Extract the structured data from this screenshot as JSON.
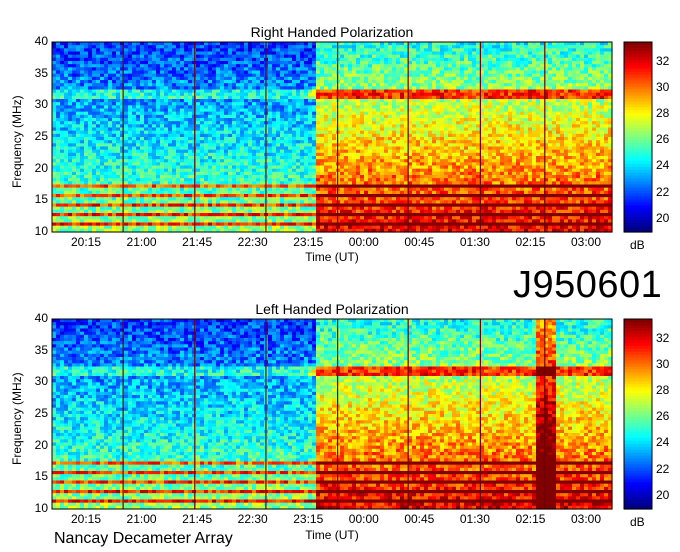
{
  "observation_id": "J950601",
  "footer_text": "Nancay Decameter Array",
  "chart_data": [
    {
      "type": "heatmap",
      "title": "Right Handed Polarization",
      "xlabel": "Time (UT)",
      "ylabel": "Frequency (MHz)",
      "x_tick_labels": [
        "20:15",
        "21:00",
        "21:45",
        "22:30",
        "23:15",
        "00:00",
        "00:45",
        "01:30",
        "02:15",
        "03:00"
      ],
      "y_ticks": [
        10,
        15,
        20,
        25,
        30,
        35,
        40
      ],
      "ylim": [
        10,
        40
      ],
      "colorbar": {
        "unit": "dB",
        "ticks": [
          20,
          22,
          24,
          26,
          28,
          30,
          32
        ],
        "range": [
          19,
          33.5
        ]
      }
    },
    {
      "type": "heatmap",
      "title": "Left Handed Polarization",
      "xlabel": "Time (UT)",
      "ylabel": "Frequency (MHz)",
      "x_tick_labels": [
        "20:15",
        "21:00",
        "21:45",
        "22:30",
        "23:15",
        "00:00",
        "00:45",
        "01:30",
        "02:15",
        "03:00"
      ],
      "y_ticks": [
        10,
        15,
        20,
        25,
        30,
        35,
        40
      ],
      "ylim": [
        10,
        40
      ],
      "colorbar": {
        "unit": "dB",
        "ticks": [
          20,
          22,
          24,
          26,
          28,
          30,
          32
        ],
        "range": [
          19,
          33.5
        ]
      }
    }
  ]
}
